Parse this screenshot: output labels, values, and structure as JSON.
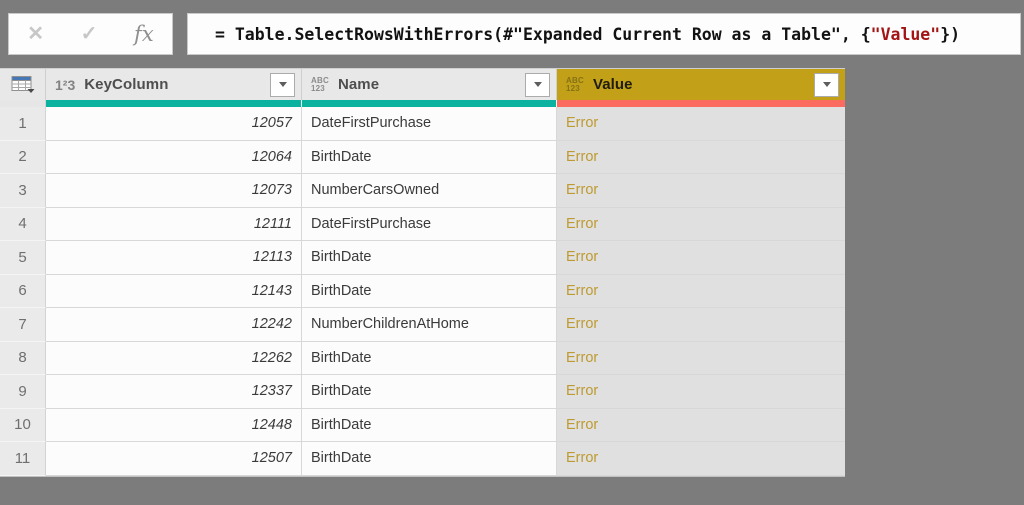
{
  "formula_bar": {
    "cancel_label": "✕",
    "check_label": "✓",
    "fx_label": "fx",
    "formula": {
      "pre": "= Table.SelectRowsWithErrors(#\"Expanded Current Row as a Table\", {",
      "string": "\"Value\"",
      "post": "})"
    }
  },
  "grid": {
    "columns": {
      "key": {
        "label": "KeyColumn",
        "type_icon": "1²3"
      },
      "name": {
        "label": "Name",
        "type_icon_top": "ABC",
        "type_icon_bottom": "123"
      },
      "value": {
        "label": "Value",
        "type_icon_top": "ABC",
        "type_icon_bottom": "123",
        "selected": true
      }
    },
    "rows": [
      {
        "num": "1",
        "key": "12057",
        "name": "DateFirstPurchase",
        "value": "Error"
      },
      {
        "num": "2",
        "key": "12064",
        "name": "BirthDate",
        "value": "Error"
      },
      {
        "num": "3",
        "key": "12073",
        "name": "NumberCarsOwned",
        "value": "Error"
      },
      {
        "num": "4",
        "key": "12111",
        "name": "DateFirstPurchase",
        "value": "Error"
      },
      {
        "num": "5",
        "key": "12113",
        "name": "BirthDate",
        "value": "Error"
      },
      {
        "num": "6",
        "key": "12143",
        "name": "BirthDate",
        "value": "Error"
      },
      {
        "num": "7",
        "key": "12242",
        "name": "NumberChildrenAtHome",
        "value": "Error"
      },
      {
        "num": "8",
        "key": "12262",
        "name": "BirthDate",
        "value": "Error"
      },
      {
        "num": "9",
        "key": "12337",
        "name": "BirthDate",
        "value": "Error"
      },
      {
        "num": "10",
        "key": "12448",
        "name": "BirthDate",
        "value": "Error"
      },
      {
        "num": "11",
        "key": "12507",
        "name": "BirthDate",
        "value": "Error"
      }
    ]
  },
  "colors": {
    "window_background": "#7C7C7C",
    "quality_ok_teal": "#0BB2A0",
    "quality_error_red": "#FB6B60",
    "selected_column_gold": "#C2A017",
    "error_link_text": "#BE9B30",
    "formula_string_red": "#A31515",
    "table_icon_blue": "#4576B5"
  }
}
